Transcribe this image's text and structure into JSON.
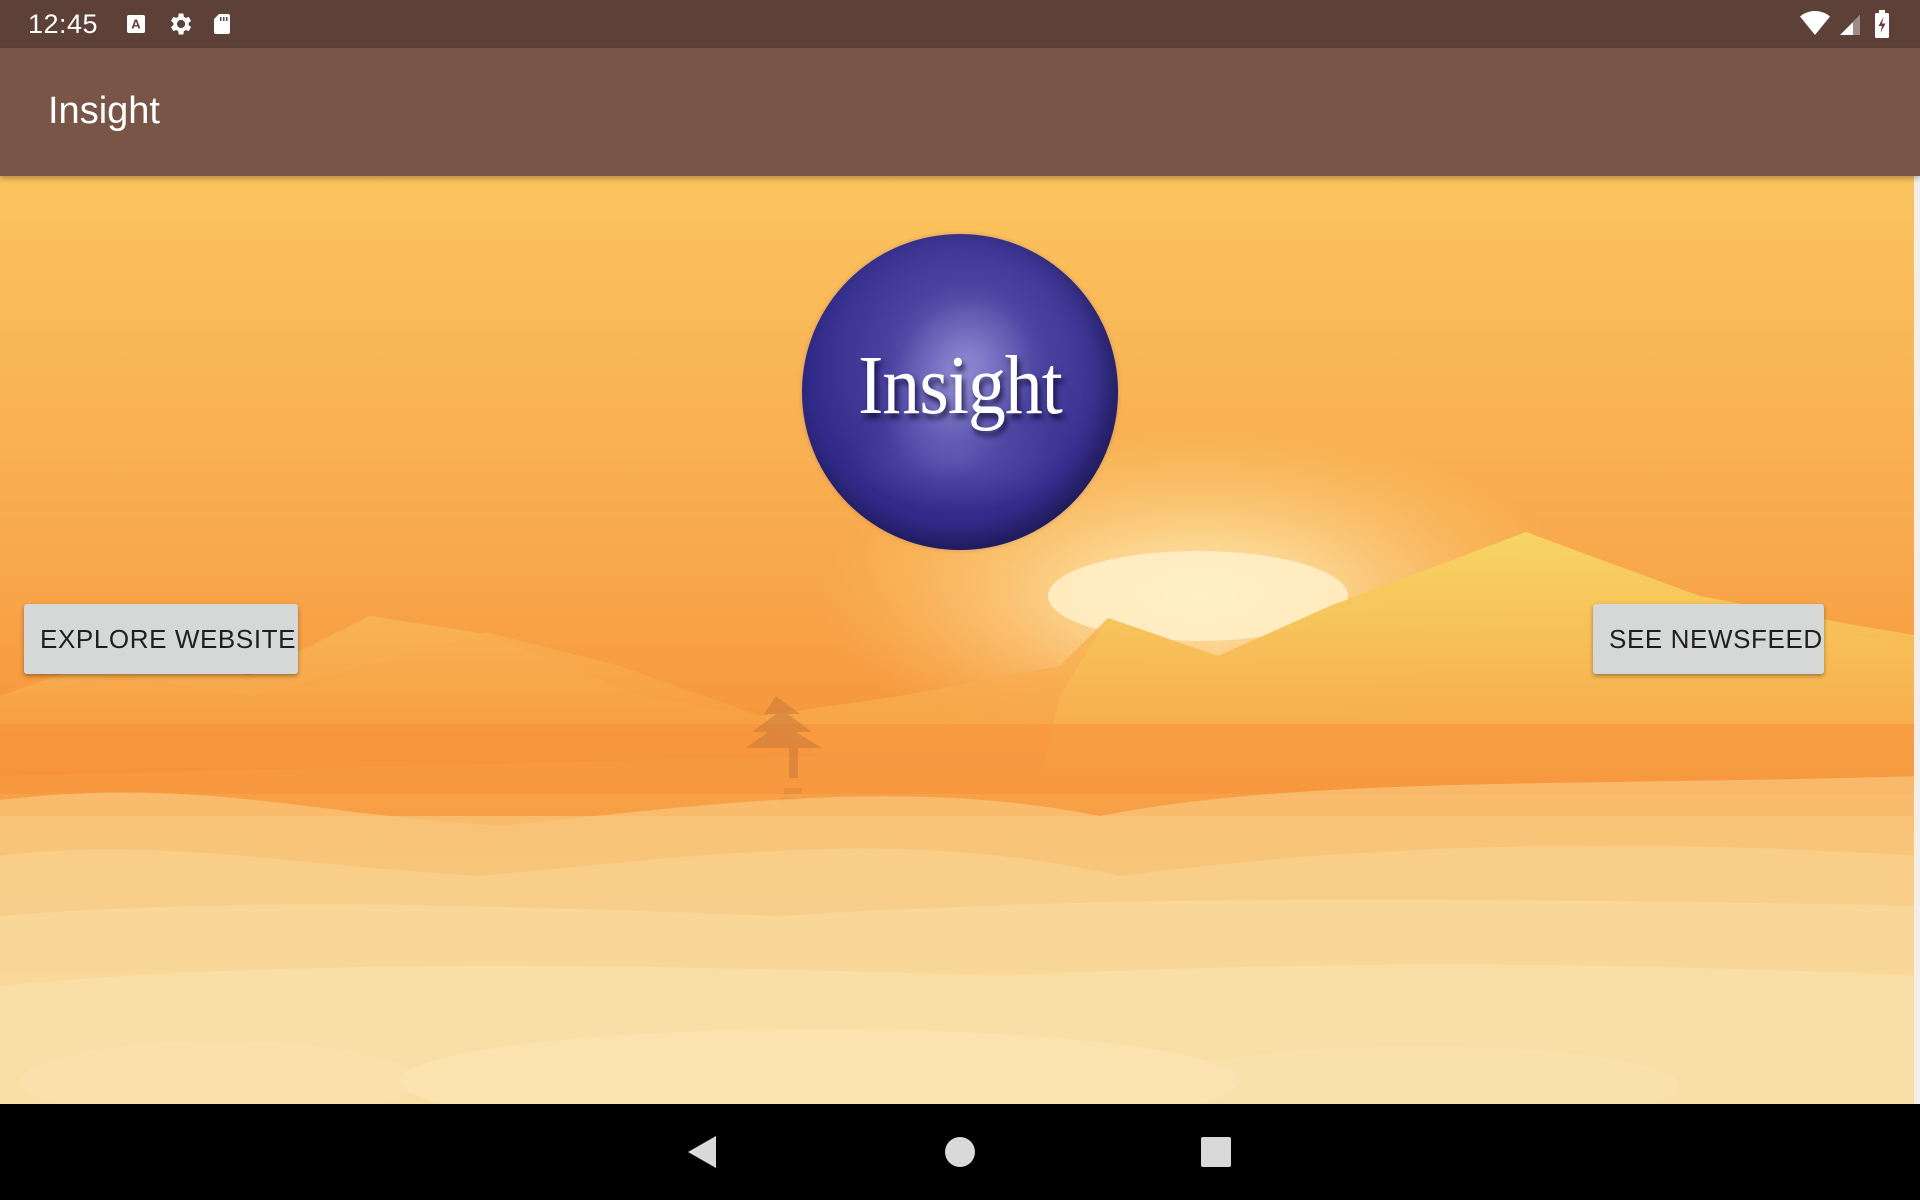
{
  "status_bar": {
    "time": "12:45",
    "left_icons": [
      "keyboard-a-icon",
      "settings-gear-icon",
      "sd-card-icon"
    ],
    "right_icons": [
      "wifi-icon",
      "cell-signal-icon",
      "battery-charging-icon"
    ]
  },
  "app_bar": {
    "title": "Insight",
    "background": "#795548",
    "status_background": "#5d4037"
  },
  "logo": {
    "text": "Insight",
    "orb_color": "#332c8c"
  },
  "buttons": {
    "explore": "EXPLORE WEBSITE",
    "newsfeed": "SEE NEWSFEED"
  },
  "nav_bar": {
    "items": [
      "back-icon",
      "home-icon",
      "recents-icon"
    ]
  }
}
